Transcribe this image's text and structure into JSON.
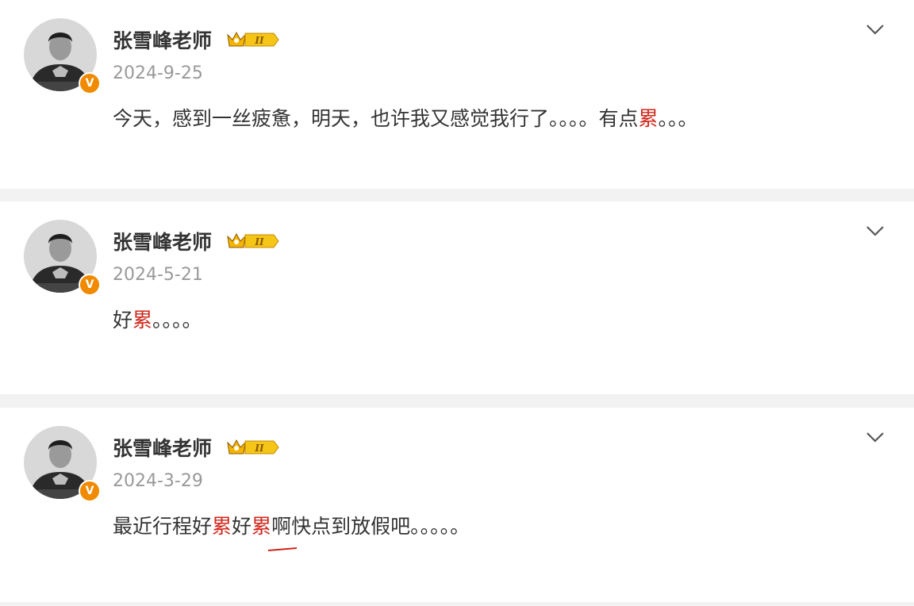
{
  "colors": {
    "highlight": "#d0261b",
    "verified_badge": "#f08a00",
    "rank_badge": "#f5c518"
  },
  "posts": [
    {
      "author": "张雪峰老师",
      "rank_label": "II",
      "verified_mark": "V",
      "date": "2024-9-25",
      "content_segments": [
        {
          "text": "今天，感到一丝疲惫，明天，也许我又感觉我行了。。。。有点"
        },
        {
          "text": "累",
          "highlight": true
        },
        {
          "text": "。。。"
        }
      ]
    },
    {
      "author": "张雪峰老师",
      "rank_label": "II",
      "verified_mark": "V",
      "date": "2024-5-21",
      "content_segments": [
        {
          "text": "好"
        },
        {
          "text": "累",
          "highlight": true
        },
        {
          "text": "。。。。"
        }
      ]
    },
    {
      "author": "张雪峰老师",
      "rank_label": "II",
      "verified_mark": "V",
      "date": "2024-3-29",
      "content_segments": [
        {
          "text": "最近行程好"
        },
        {
          "text": "累",
          "highlight": true
        },
        {
          "text": "好"
        },
        {
          "text": "累",
          "highlight": true
        },
        {
          "text": "啊快点到放假吧。。。。。"
        }
      ]
    }
  ],
  "icons": {
    "menu": "chevron-down-icon",
    "rank": "crown-rank-badge-icon",
    "verified": "verified-v-badge-icon",
    "avatar": "avatar-photo"
  }
}
